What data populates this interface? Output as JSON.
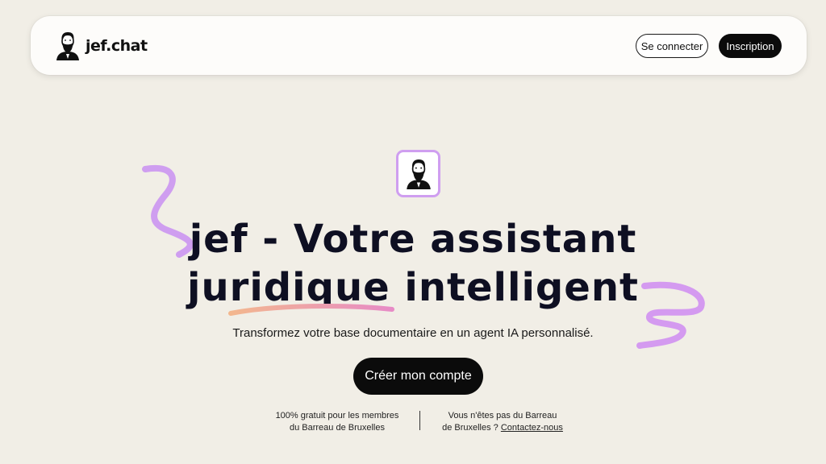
{
  "header": {
    "brand": "jef.chat",
    "login_label": "Se connecter",
    "signup_label": "Inscription"
  },
  "hero": {
    "title_line1": "jef - Votre assistant",
    "title_line2_highlight": "juridique",
    "title_line2_rest": "intelligent",
    "subtitle": "Transformez votre base documentaire en un agent IA personnalisé.",
    "cta_label": "Créer mon compte"
  },
  "footer_note": {
    "left_line1": "100% gratuit pour les membres",
    "left_line2": "du Barreau de Bruxelles",
    "right_line1": "Vous n'êtes pas du Barreau",
    "right_line2": "de Bruxelles ?",
    "right_link": "Contactez-nous"
  },
  "colors": {
    "background": "#f1eee6",
    "accent_purple": "#cf9ef0",
    "underline_orange": "#f2b48b",
    "underline_pink": "#e890c6"
  }
}
